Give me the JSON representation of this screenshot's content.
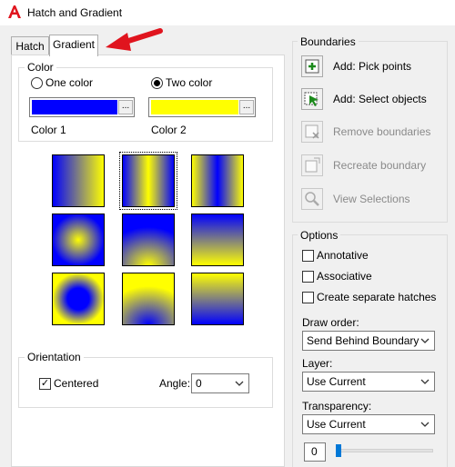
{
  "window": {
    "title": "Hatch and Gradient"
  },
  "tabs": [
    {
      "label": "Hatch",
      "active": false
    },
    {
      "label": "Gradient",
      "active": true
    }
  ],
  "color": {
    "group_label": "Color",
    "one_color_label": "One color",
    "two_color_label": "Two color",
    "selected_mode": "two_color",
    "color1_label": "Color 1",
    "color2_label": "Color 2",
    "color1_value": "#0000ff",
    "color2_value": "#ffff00",
    "browse_label": "..."
  },
  "gradient_patterns": [
    {
      "name": "linear",
      "selected": false
    },
    {
      "name": "cylinder",
      "selected": true
    },
    {
      "name": "inverted-cylinder",
      "selected": false
    },
    {
      "name": "spherical",
      "selected": false
    },
    {
      "name": "hemispherical",
      "selected": false
    },
    {
      "name": "curved",
      "selected": false
    },
    {
      "name": "inverted-spherical",
      "selected": false
    },
    {
      "name": "inverted-hemispherical",
      "selected": false
    },
    {
      "name": "inverted-curved",
      "selected": false
    }
  ],
  "orientation": {
    "group_label": "Orientation",
    "centered_label": "Centered",
    "centered_checked": true,
    "angle_label": "Angle:",
    "angle_value": "0"
  },
  "boundaries": {
    "group_label": "Boundaries",
    "buttons": [
      {
        "label": "Add: Pick points",
        "icon": "pick-points-icon",
        "enabled": true
      },
      {
        "label": "Add: Select objects",
        "icon": "select-objects-icon",
        "enabled": true
      },
      {
        "label": "Remove boundaries",
        "icon": "remove-boundaries-icon",
        "enabled": false
      },
      {
        "label": "Recreate boundary",
        "icon": "recreate-boundary-icon",
        "enabled": false
      },
      {
        "label": "View Selections",
        "icon": "view-selections-icon",
        "enabled": false
      }
    ]
  },
  "options": {
    "group_label": "Options",
    "annotative_label": "Annotative",
    "annotative_checked": false,
    "associative_label": "Associative",
    "associative_checked": false,
    "separate_hatches_label": "Create separate hatches",
    "separate_hatches_checked": false,
    "draw_order_label": "Draw order:",
    "draw_order_value": "Send Behind Boundary",
    "layer_label": "Layer:",
    "layer_value": "Use Current",
    "transparency_label": "Transparency:",
    "transparency_value": "Use Current",
    "transparency_amount": "0"
  },
  "colors": {
    "accent_red": "#e0141e",
    "blue": "#0000ff",
    "yellow": "#ffff00"
  }
}
